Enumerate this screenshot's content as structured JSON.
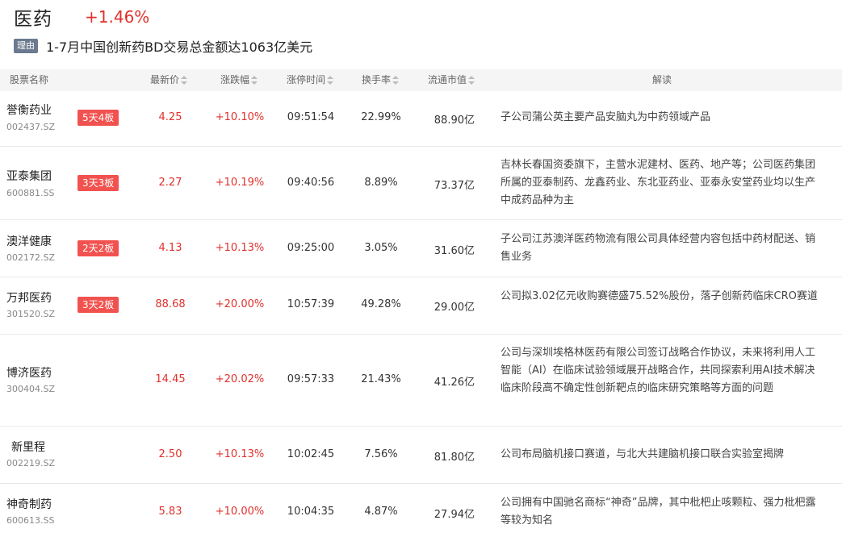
{
  "header": {
    "sector_name": "医药",
    "sector_change": "+1.46%"
  },
  "reason": {
    "tag": "理由",
    "text": "1-7月中国创新药BD交易总金额达1063亿美元"
  },
  "table": {
    "columns": {
      "name": "股票名称",
      "price": "最新价",
      "change": "涨跌幅",
      "limit_time": "涨停时间",
      "turnover": "换手率",
      "float_cap": "流通市值",
      "interpretation": "解读"
    },
    "rows": [
      {
        "name": "誉衡药业",
        "code": "002437.SZ",
        "badge": "5天4板",
        "price": "4.25",
        "change": "+10.10%",
        "limit_time": "09:51:54",
        "turnover": "22.99%",
        "float_cap": "88.90亿",
        "interpretation": "子公司蒲公英主要产品安脑丸为中药领域产品"
      },
      {
        "name": "亚泰集团",
        "code": "600881.SS",
        "badge": "3天3板",
        "price": "2.27",
        "change": "+10.19%",
        "limit_time": "09:40:56",
        "turnover": "8.89%",
        "float_cap": "73.37亿",
        "interpretation": "吉林长春国资委旗下，主营水泥建材、医药、地产等；公司医药集团所属的亚泰制药、龙鑫药业、东北亚药业、亚泰永安堂药业均以生产中成药品种为主"
      },
      {
        "name": "澳洋健康",
        "code": "002172.SZ",
        "badge": "2天2板",
        "price": "4.13",
        "change": "+10.13%",
        "limit_time": "09:25:00",
        "turnover": "3.05%",
        "float_cap": "31.60亿",
        "interpretation": "子公司江苏澳洋医药物流有限公司具体经营内容包括中药材配送、销售业务"
      },
      {
        "name": "万邦医药",
        "code": "301520.SZ",
        "badge": "3天2板",
        "price": "88.68",
        "change": "+20.00%",
        "limit_time": "10:57:39",
        "turnover": "49.28%",
        "float_cap": "29.00亿",
        "interpretation": "公司拟3.02亿元收购赛德盛75.52%股份，落子创新药临床CRO赛道"
      },
      {
        "name": "博济医药",
        "code": "300404.SZ",
        "badge": "",
        "price": "14.45",
        "change": "+20.02%",
        "limit_time": "09:57:33",
        "turnover": "21.43%",
        "float_cap": "41.26亿",
        "interpretation": "公司与深圳埃格林医药有限公司签订战略合作协议，未来将利用人工智能（AI）在临床试验领域展开战略合作，共同探索利用AI技术解决临床阶段高不确定性创新靶点的临床研究策略等方面的问题"
      },
      {
        "name": "新里程",
        "code": "002219.SZ",
        "badge": "",
        "price": "2.50",
        "change": "+10.13%",
        "limit_time": "10:02:45",
        "turnover": "7.56%",
        "float_cap": "81.80亿",
        "interpretation": "公司布局脑机接口赛道，与北大共建脑机接口联合实验室揭牌"
      },
      {
        "name": "神奇制药",
        "code": "600613.SS",
        "badge": "",
        "price": "5.83",
        "change": "+10.00%",
        "limit_time": "10:04:35",
        "turnover": "4.87%",
        "float_cap": "27.94亿",
        "interpretation": "公司拥有中国驰名商标“神奇”品牌，其中枇杷止咳颗粒、强力枇杷露等较为知名"
      }
    ]
  },
  "colors": {
    "up": "#e0312c",
    "badge": "#f2524f",
    "reason_tag": "#6b7a8f"
  }
}
